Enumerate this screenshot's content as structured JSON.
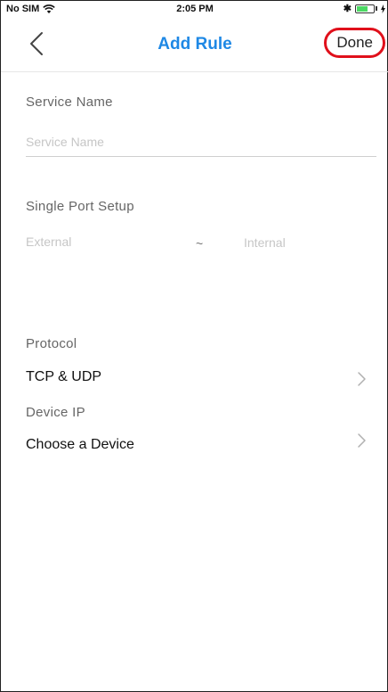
{
  "status_bar": {
    "carrier": "No SIM",
    "time": "2:05 PM",
    "bluetooth": "✱"
  },
  "nav": {
    "title": "Add Rule",
    "done_label": "Done"
  },
  "form": {
    "service_name": {
      "label": "Service Name",
      "placeholder": "Service Name",
      "value": ""
    },
    "single_port": {
      "label": "Single Port Setup",
      "external_placeholder": "External",
      "separator": "~",
      "internal_placeholder": "Internal"
    },
    "protocol": {
      "label": "Protocol",
      "value": "TCP & UDP"
    },
    "device_ip": {
      "label": "Device IP",
      "value": "Choose a Device"
    }
  },
  "colors": {
    "title_blue": "#1e88e5",
    "highlight_red": "#e0101b"
  }
}
